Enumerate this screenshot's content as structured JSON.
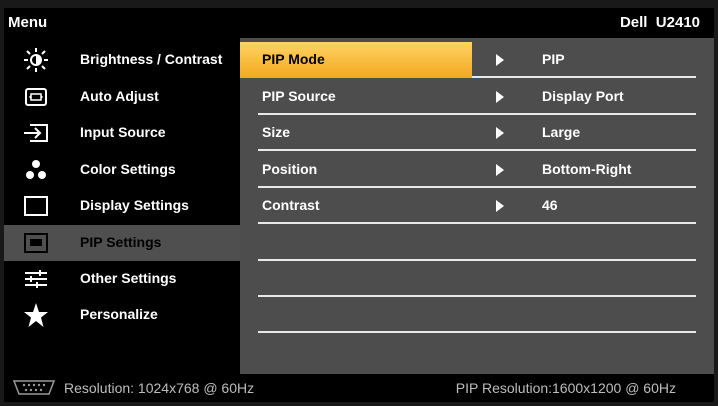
{
  "header": {
    "menu_title": "Menu",
    "model": "Dell  U2410"
  },
  "sidebar": {
    "items": [
      {
        "label": "Brightness / Contrast",
        "icon": "brightness-icon"
      },
      {
        "label": "Auto Adjust",
        "icon": "auto-adjust-icon"
      },
      {
        "label": "Input Source",
        "icon": "input-source-icon"
      },
      {
        "label": "Color Settings",
        "icon": "color-settings-icon"
      },
      {
        "label": "Display Settings",
        "icon": "display-settings-icon"
      },
      {
        "label": "PIP Settings",
        "icon": "pip-settings-icon",
        "selected": true
      },
      {
        "label": "Other Settings",
        "icon": "other-settings-icon"
      },
      {
        "label": "Personalize",
        "icon": "star-icon"
      }
    ]
  },
  "panel": {
    "rows": [
      {
        "name": "PIP Mode",
        "value": "PIP"
      },
      {
        "name": "PIP Source",
        "value": "Display Port"
      },
      {
        "name": "Size",
        "value": "Large"
      },
      {
        "name": "Position",
        "value": "Bottom-Right"
      },
      {
        "name": "Contrast",
        "value": "46"
      }
    ],
    "active_row": "PIP Mode"
  },
  "footer": {
    "connector_icon": "vga-connector-icon",
    "resolution": "Resolution: 1024x768 @ 60Hz",
    "pip_resolution": "PIP Resolution:1600x1200 @ 60Hz"
  },
  "colors": {
    "highlight_top": "#ffd366",
    "highlight_bottom": "#f2a81c",
    "panel_bg": "#4d4d4d",
    "sidebar_bg": "#000000",
    "selected_bg": "#4f4f4f"
  }
}
